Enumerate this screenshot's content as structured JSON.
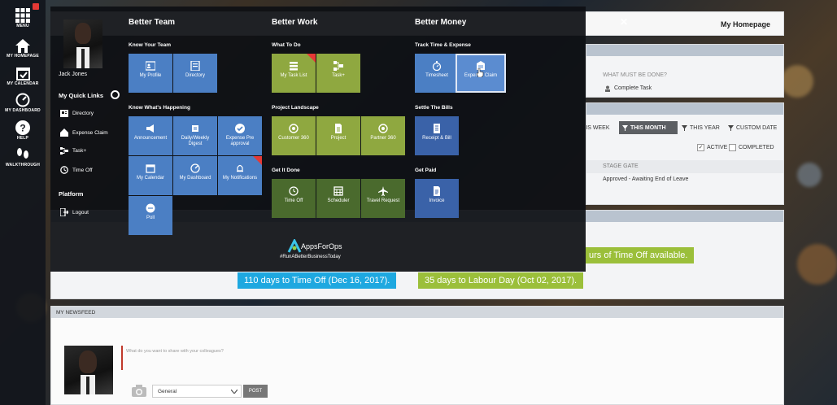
{
  "rail": {
    "menu": "MENU",
    "homepage": "MY HOMEPAGE",
    "calendar": "MY CALENDAR",
    "dashboard": "MY DASHBOARD",
    "help": "HELP",
    "walkthrough": "WALKTHROUGH"
  },
  "header": {
    "homepage_link": "My Homepage"
  },
  "background": {
    "what_must_be_done": "WHAT MUST BE DONE?",
    "complete_task": "Complete Task",
    "filters": [
      "THIS WEEK",
      "THIS MONTH",
      "THIS YEAR",
      "CUSTOM DATE"
    ],
    "active": "ACTIVE",
    "completed": "COMPLETED",
    "stage_gate": "STAGE GATE",
    "stage_value": "Approved - Awaiting End of Leave",
    "time_off_note": "urs of Time Off available.",
    "countdown1": "110 days to Time Off (Dec 16, 2017).",
    "countdown2": "35 days to Labour Day (Oct 02, 2017).",
    "newsfeed": "MY NEWSFEED",
    "share_placeholder": "What do you want to share with your colleagues?",
    "general": "General",
    "post": "POST"
  },
  "user": {
    "name": "Jack Jones"
  },
  "quick_links": {
    "title": "My Quick Links",
    "items": [
      "Directory",
      "Expense Claim",
      "Task+",
      "Time Off"
    ],
    "platform": "Platform",
    "logout": "Logout"
  },
  "columns": {
    "team": {
      "title": "Better Team",
      "know_team": "Know Your Team",
      "know_happening": "Know What's Happening",
      "tiles_team": [
        "My Profile",
        "Directory"
      ],
      "tiles_happening": [
        "Announcement",
        "Daily/Weekly Digest",
        "Expense Pre approval",
        "My Calendar",
        "My Dashboard",
        "My Notifications",
        "Poll"
      ]
    },
    "work": {
      "title": "Better Work",
      "what_to_do": "What To Do",
      "project_landscape": "Project Landscape",
      "get_it_done": "Get It Done",
      "tiles_todo": [
        "My Task List",
        "Task+"
      ],
      "tiles_project": [
        "Customer 360",
        "Project",
        "Partner 360"
      ],
      "tiles_done": [
        "Time Off",
        "Scheduler",
        "Travel Request"
      ]
    },
    "money": {
      "title": "Better Money",
      "track": "Track Time & Expense",
      "settle": "Settle The Bills",
      "get_paid": "Get Paid",
      "tiles_track": [
        "Timesheet",
        "Expense Claim"
      ],
      "tiles_settle": [
        "Receipt & Bill"
      ],
      "tiles_paid": [
        "Invoice"
      ]
    }
  },
  "brand": {
    "name": "AppsForOps",
    "tagline": "#RunABetterBusinessToday"
  },
  "colors": {
    "tile_blue": "#4b7fc4",
    "tile_green": "#8fa840",
    "tile_dark_green": "#4a6a2d",
    "countdown_blue": "#1ea8e0",
    "countdown_green": "#9bbf3a"
  }
}
